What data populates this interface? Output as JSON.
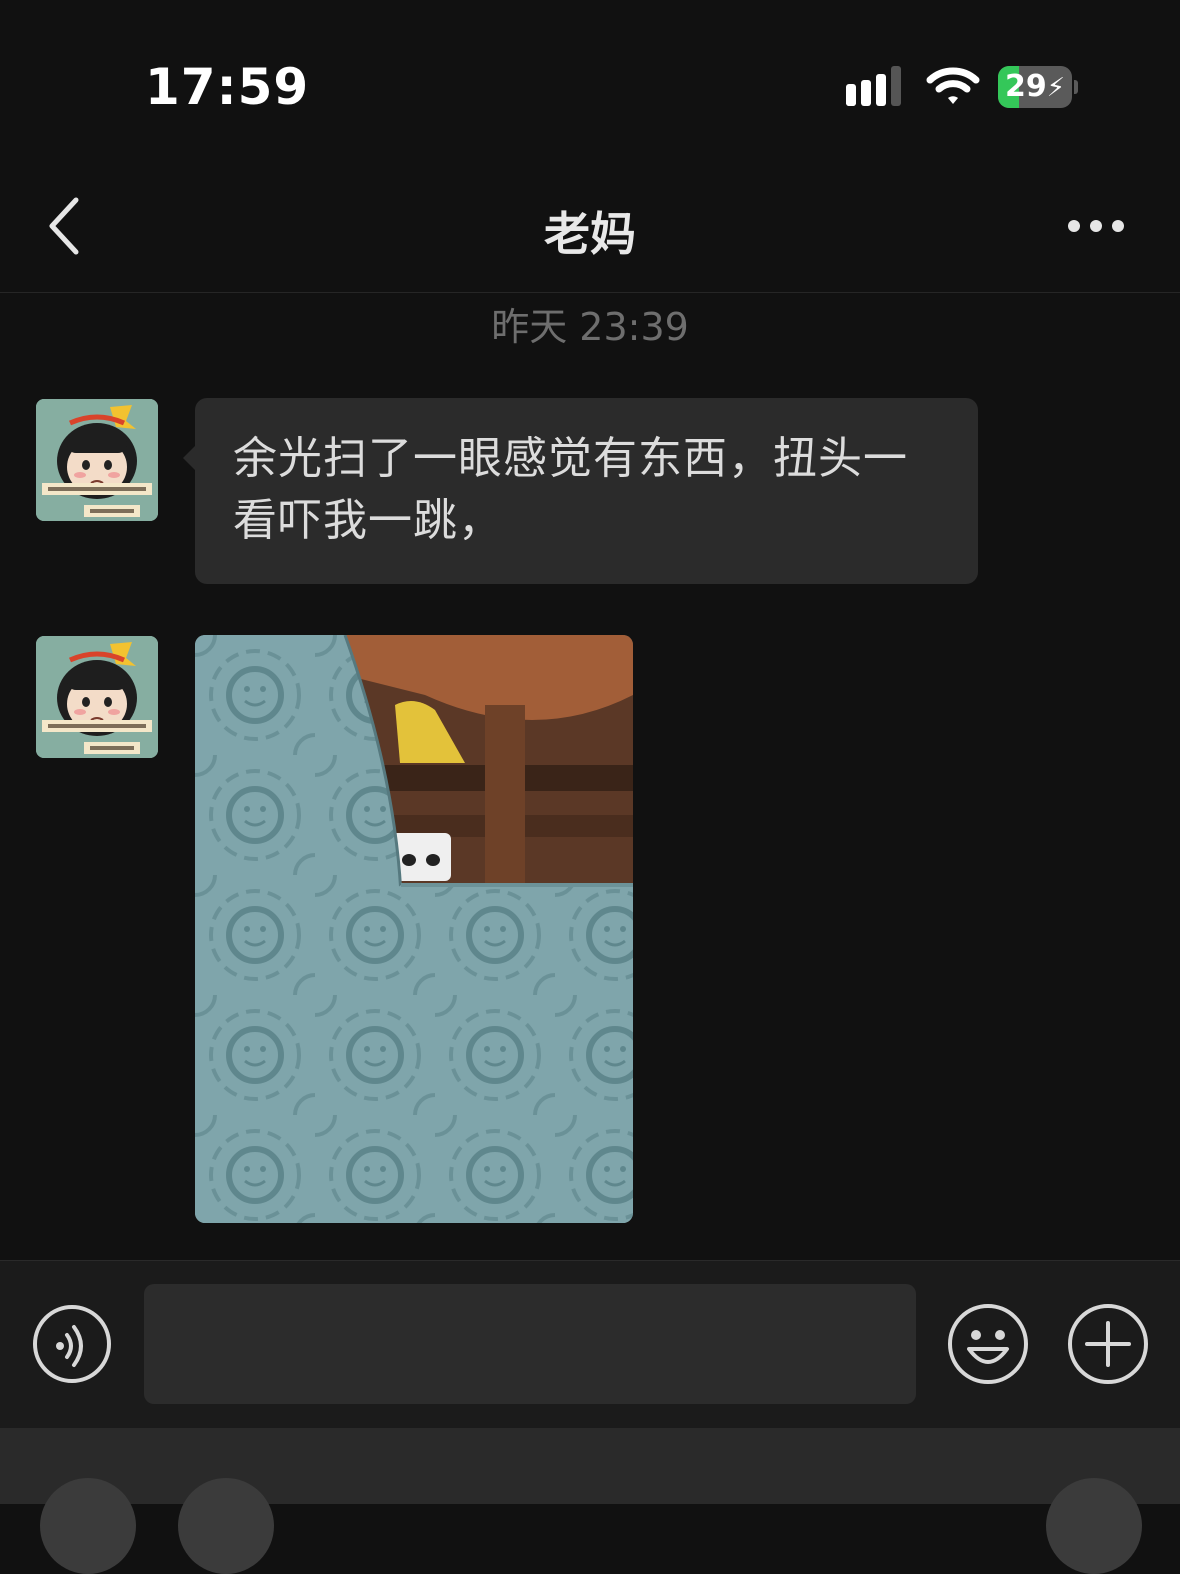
{
  "status_bar": {
    "time": "17:59",
    "battery_level": "29",
    "battery_fraction": 0.29,
    "battery_color": "#34c759",
    "icons": [
      "signal-icon",
      "wifi-icon",
      "charging-bolt-icon"
    ]
  },
  "nav": {
    "title": "老妈",
    "back_icon": "chevron-left-icon",
    "more_icon": "more-dots-icon"
  },
  "chat": {
    "timestamp": "昨天 23:39",
    "messages": [
      {
        "type": "text",
        "sender": "老妈",
        "text": "余光扫了一眼感觉有东西，扭头一看吓我一跳，"
      },
      {
        "type": "image",
        "sender": "老妈"
      }
    ]
  },
  "input_bar": {
    "voice_icon": "voice-icon",
    "input_value": "",
    "emoji_icon": "emoji-icon",
    "plus_icon": "plus-icon"
  }
}
